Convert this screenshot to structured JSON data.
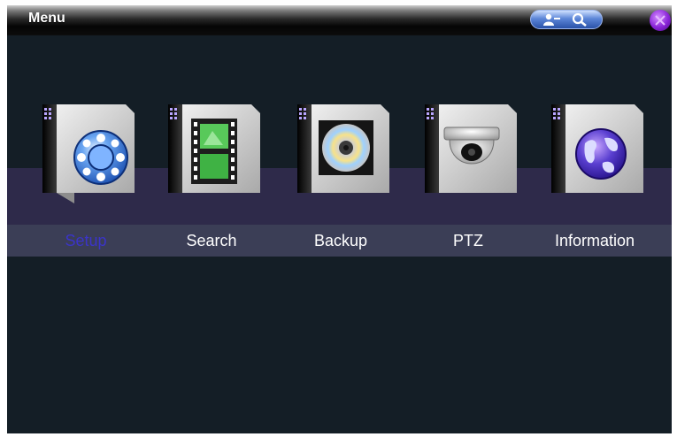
{
  "window": {
    "title": "Menu"
  },
  "toolbar": {
    "user_icon": "user-icon",
    "search_icon": "magnifier-icon",
    "close_icon": "close-icon"
  },
  "menu": {
    "items": [
      {
        "label": "Setup",
        "icon": "setup-gear-icon",
        "selected": true
      },
      {
        "label": "Search",
        "icon": "film-strip-icon",
        "selected": false
      },
      {
        "label": "Backup",
        "icon": "disc-icon",
        "selected": false
      },
      {
        "label": "PTZ",
        "icon": "dome-camera-icon",
        "selected": false
      },
      {
        "label": "Information",
        "icon": "globe-icon",
        "selected": false
      }
    ]
  },
  "colors": {
    "background": "#141e26",
    "band": "#2e2a4a",
    "label_bar": "#3b3e56",
    "selected_text": "#3b34c8",
    "text": "#ffffff"
  }
}
